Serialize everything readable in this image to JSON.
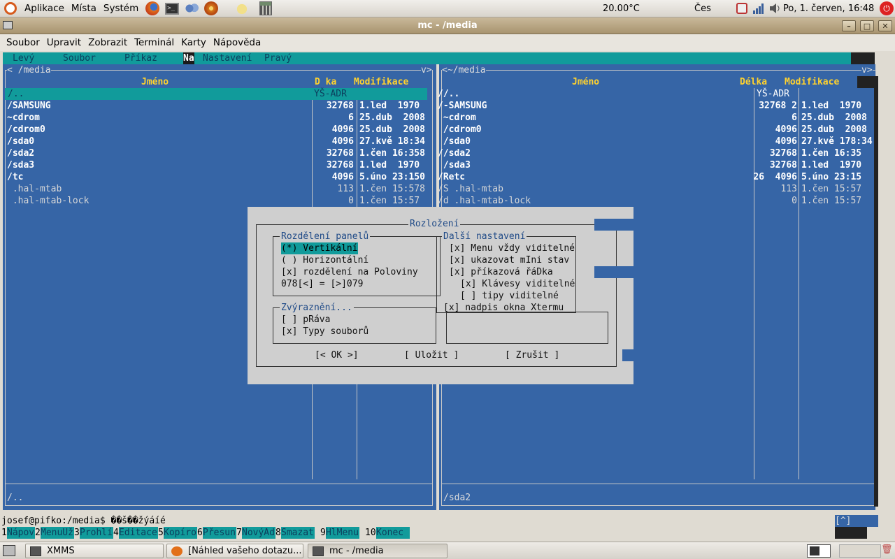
{
  "top_panel": {
    "menus": [
      "Aplikace",
      "Místa",
      "Systém"
    ],
    "temperature": "20.00°C",
    "keyboard": "Čes",
    "datetime": "Po,  1. červen, 16:48"
  },
  "window": {
    "title": "mc - /media",
    "menubar": [
      "Soubor",
      "Upravit",
      "Zobrazit",
      "Terminál",
      "Karty",
      "Nápověda"
    ]
  },
  "mc_menu": [
    "Levý",
    "Soubor",
    "Příkaz",
    "Na",
    "Nastavení",
    "Pravý"
  ],
  "left_panel": {
    "path": "/media",
    "headers": {
      "name": "Jméno",
      "size": "D ka",
      "mod": "Modifikace"
    },
    "cursor_row": {
      "name": "/..",
      "size": "YŠ-ADR"
    },
    "rows": [
      {
        "name": "/SAMSUNG",
        "size": "32768",
        "mod": "1.led  1970"
      },
      {
        "name": "~cdrom",
        "size": "6",
        "mod": "25.dub  2008"
      },
      {
        "name": "/cdrom0",
        "size": "4096",
        "mod": "25.dub  2008"
      },
      {
        "name": "/sda0",
        "size": "4096",
        "mod": "27.kvě 18:34"
      },
      {
        "name": "/sda2",
        "size": "32768",
        "mod": "1.čen 16:358"
      },
      {
        "name": "/sda3",
        "size": "32768",
        "mod": "1.led  1970"
      },
      {
        "name": "/tc",
        "size": "4096",
        "mod": "5.úno 23:150"
      },
      {
        "name": " .hal-mtab",
        "size": "113",
        "mod": "1.čen 15:578"
      },
      {
        "name": " .hal-mtab-lock",
        "size": "0",
        "mod": "1.čen 15:57"
      }
    ],
    "status": "/.."
  },
  "right_panel": {
    "path": "<~/media",
    "headers": {
      "name": "Jméno",
      "size": "Délka",
      "mod": "Modifikace"
    },
    "cursor_row": {
      "name": "//..",
      "size": "YŠ-ADR"
    },
    "rows": [
      {
        "name": "/-SAMSUNG",
        "size": "32768 2",
        "mod": "1.led  1970"
      },
      {
        "name": " ~cdrom",
        "size": "6",
        "mod": "25.dub  2008"
      },
      {
        "name": " /cdrom0",
        "size": "4096",
        "mod": "25.dub  2008"
      },
      {
        "name": " /sda0",
        "size": "4096",
        "mod": "27.kvě 178:34"
      },
      {
        "name": "//sda2",
        "size": "32768",
        "mod": "1.čen 16:35"
      },
      {
        "name": " /sda3",
        "size": "32768",
        "mod": "1.led  1970"
      },
      {
        "name": "/Retc",
        "size": "26  4096",
        "mod": "5.úno 23:15"
      },
      {
        "name": "/S .hal-mtab",
        "size": "113",
        "mod": "1.čen 15:57"
      },
      {
        "name": "/d .hal-mtab-lock",
        "size": "0",
        "mod": "1.čen 15:57"
      }
    ],
    "status": "/sda2"
  },
  "dialog": {
    "title": "Rozložení",
    "group_split": {
      "title": "Rozdělení panelů",
      "options": [
        "(*) Vertikální",
        "( ) Horizontální",
        "[x] rozdělení na Poloviny",
        "078[<] = [>]079"
      ]
    },
    "group_other": {
      "title": "Další nastavení",
      "options": [
        "[x] Menu vždy viditelné",
        "[x] ukazovat mIni stav",
        "[x] příkazová řáDka",
        "[x] Klávesy viditelné",
        "[ ] tipy viditelné",
        "[x] nadpis okna Xtermu"
      ]
    },
    "group_highlight": {
      "title": "Zvýraznění...",
      "options": [
        "[ ] pRáva",
        "[x] Typy souborů"
      ]
    },
    "buttons": {
      "ok": "[< OK >]",
      "save": "[ Uložit ]",
      "cancel": "[ Zrušit ]"
    }
  },
  "command_line": "josef@pifko:/media$ ��š��žýáíé",
  "scroll_hint": "[^]",
  "fkeys": [
    {
      "num": "1",
      "label": "Nápov"
    },
    {
      "num": "2",
      "label": "MenuUž"
    },
    {
      "num": "3",
      "label": "Prohlí"
    },
    {
      "num": "4",
      "label": "Editace"
    },
    {
      "num": "5",
      "label": "Kopíro"
    },
    {
      "num": "6",
      "label": "Přesun"
    },
    {
      "num": "7",
      "label": "NovýAd"
    },
    {
      "num": "8",
      "label": "Smazat"
    },
    {
      "num": "9",
      "label": "HlMenu"
    },
    {
      "num": "10",
      "label": "Konec"
    }
  ],
  "taskbar": {
    "tasks": [
      "XMMS",
      "[Náhled vašeho dotazu...",
      "mc - /media"
    ]
  }
}
